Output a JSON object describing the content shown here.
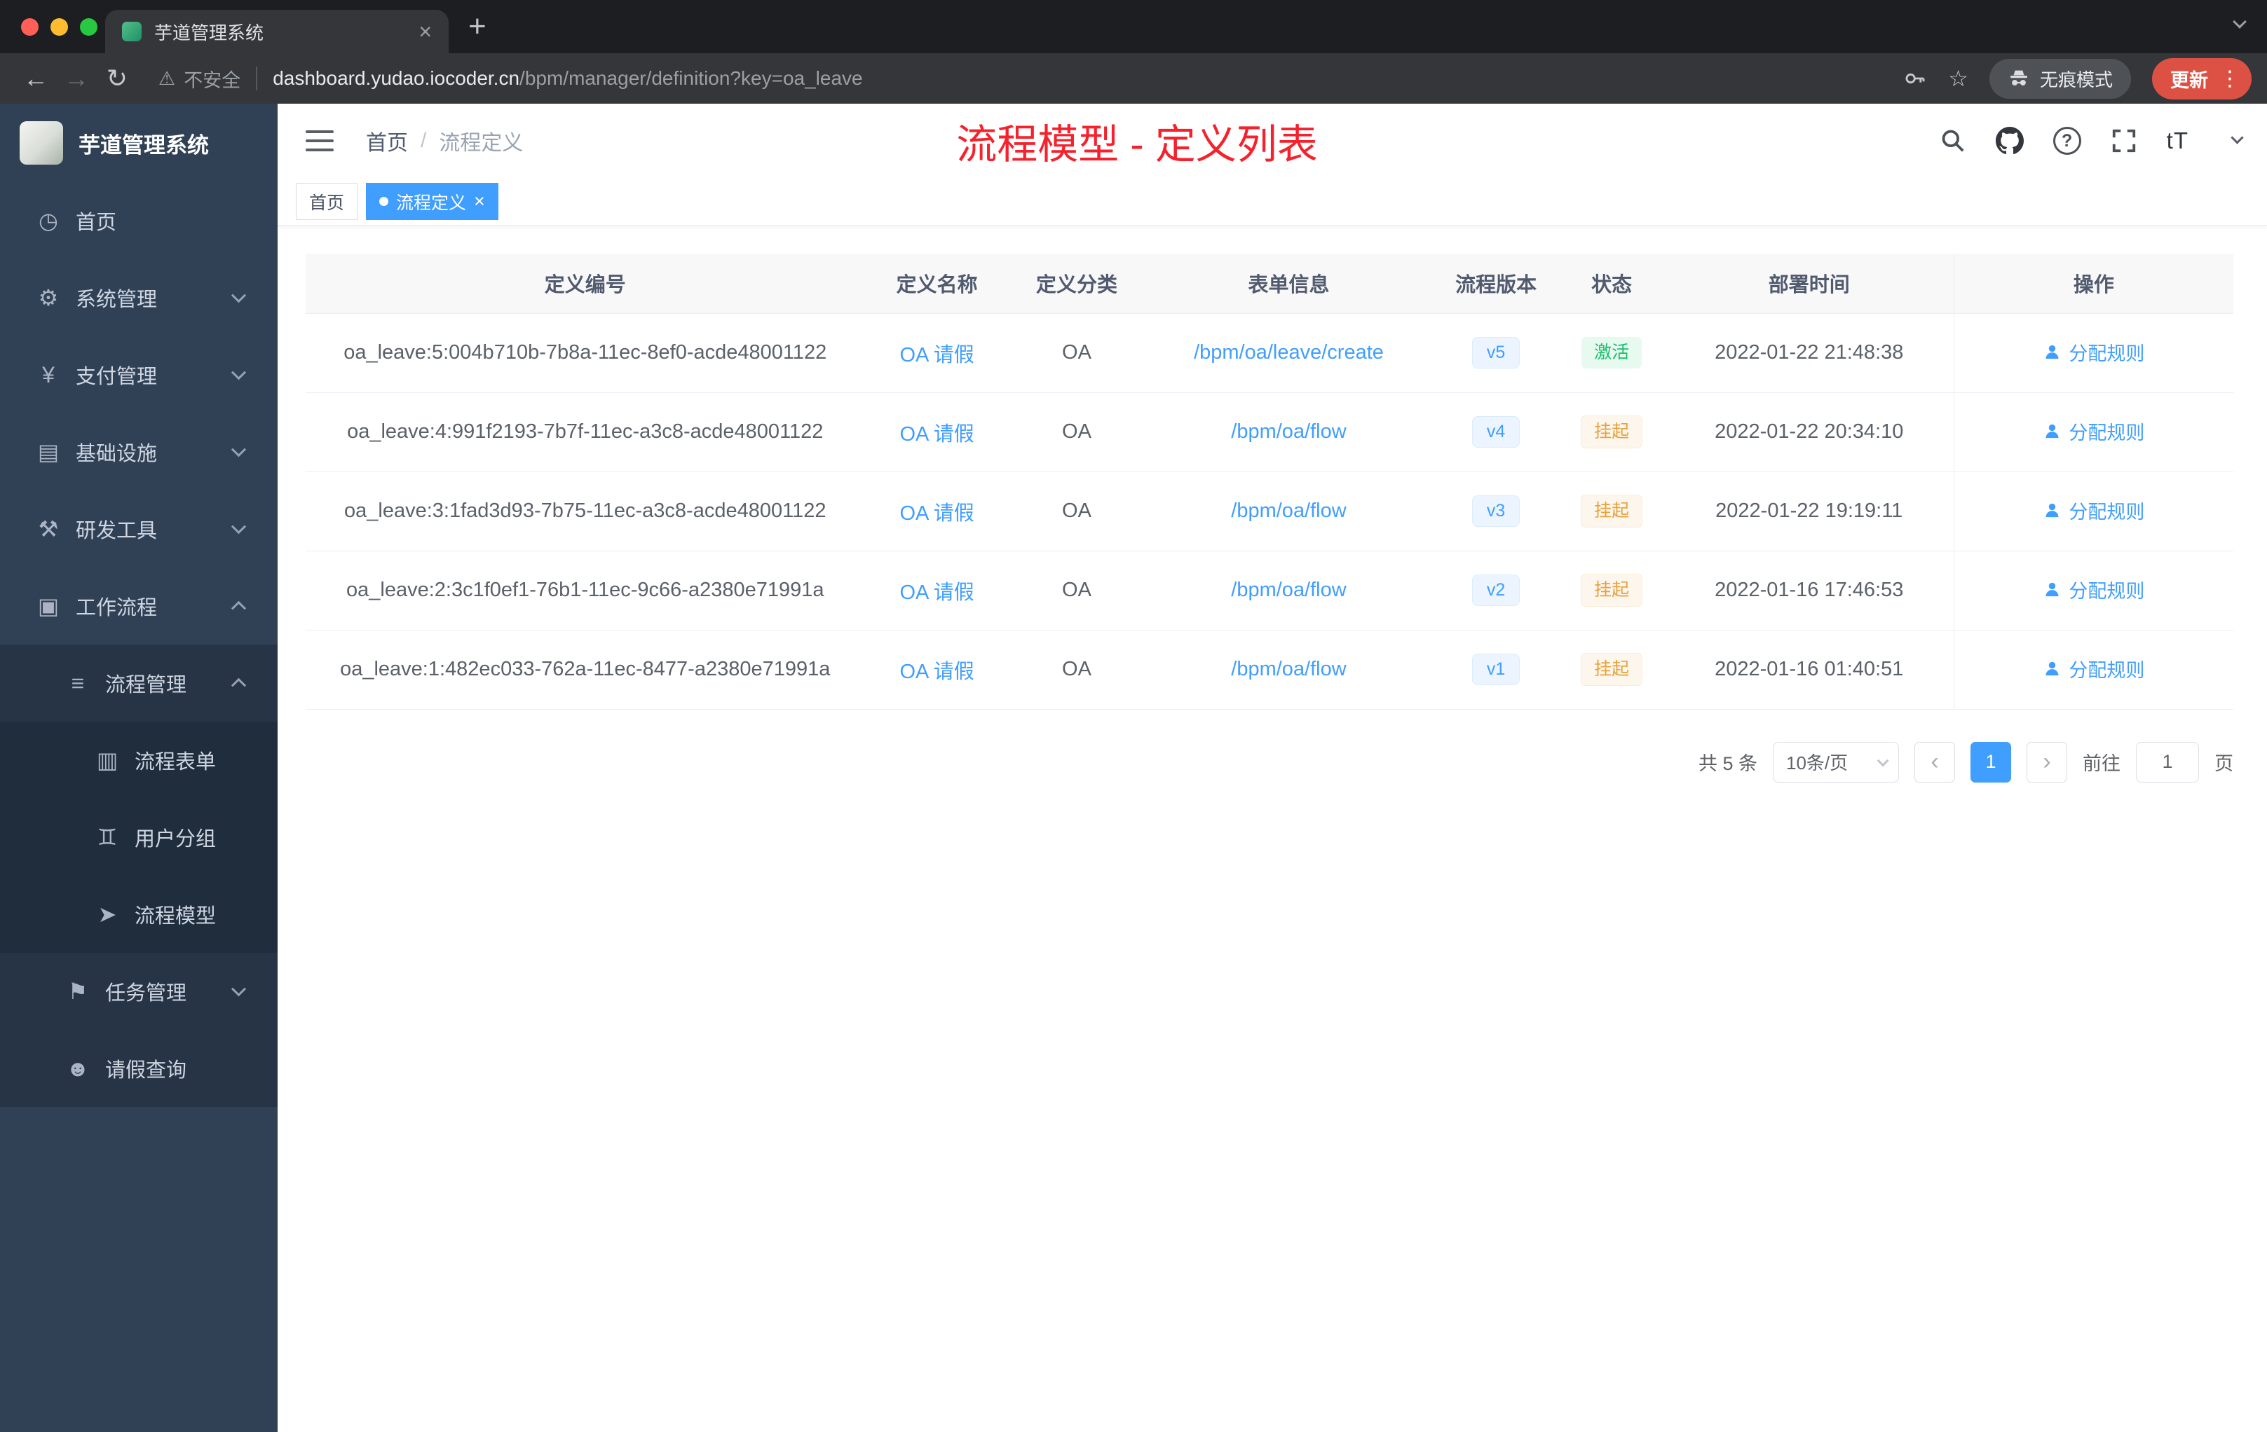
{
  "browser": {
    "tab_title": "芋道管理系统",
    "security_label": "不安全",
    "url_host": "dashboard.yudao.iocoder.cn",
    "url_path": "/bpm/manager/definition?key=oa_leave",
    "incognito_label": "无痕模式",
    "update_label": "更新"
  },
  "icons": {
    "back": "←",
    "forward": "→",
    "reload": "↻",
    "warning": "⚠",
    "star": "☆",
    "more": "⋮",
    "new_tab": "+",
    "tab_close": "×",
    "tag_close": "×",
    "help": "?",
    "text_size": "tT",
    "prev": "‹",
    "next": "›"
  },
  "sidebar": {
    "logo_title": "芋道管理系统",
    "menu": [
      {
        "label": "首页",
        "icon": "◷"
      },
      {
        "label": "系统管理",
        "icon": "⚙"
      },
      {
        "label": "支付管理",
        "icon": "¥"
      },
      {
        "label": "基础设施",
        "icon": "▤"
      },
      {
        "label": "研发工具",
        "icon": "⚒"
      },
      {
        "label": "工作流程",
        "icon": "▣"
      },
      {
        "label": "流程管理",
        "icon": "≡"
      },
      {
        "label": "流程表单",
        "icon": "▥"
      },
      {
        "label": "用户分组",
        "icon": "♊"
      },
      {
        "label": "流程模型",
        "icon": "➤"
      },
      {
        "label": "任务管理",
        "icon": "⚑"
      },
      {
        "label": "请假查询",
        "icon": "☻"
      }
    ]
  },
  "navbar": {
    "breadcrumb_home": "首页",
    "breadcrumb_sep": "/",
    "breadcrumb_current": "流程定义",
    "annotation": "流程模型 - 定义列表"
  },
  "tags": {
    "home": "首页",
    "active": "流程定义"
  },
  "table": {
    "columns": {
      "id": "定义编号",
      "name": "定义名称",
      "category": "定义分类",
      "form": "表单信息",
      "version": "流程版本",
      "status": "状态",
      "time": "部署时间",
      "actions": "操作"
    },
    "rows": [
      {
        "id": "oa_leave:5:004b710b-7b8a-11ec-8ef0-acde48001122",
        "name": "OA 请假",
        "category": "OA",
        "form": "/bpm/oa/leave/create",
        "version": "v5",
        "status": "激活",
        "time": "2022-01-22 21:48:38",
        "action": "分配规则"
      },
      {
        "id": "oa_leave:4:991f2193-7b7f-11ec-a3c8-acde48001122",
        "name": "OA 请假",
        "category": "OA",
        "form": "/bpm/oa/flow",
        "version": "v4",
        "status": "挂起",
        "time": "2022-01-22 20:34:10",
        "action": "分配规则"
      },
      {
        "id": "oa_leave:3:1fad3d93-7b75-11ec-a3c8-acde48001122",
        "name": "OA 请假",
        "category": "OA",
        "form": "/bpm/oa/flow",
        "version": "v3",
        "status": "挂起",
        "time": "2022-01-22 19:19:11",
        "action": "分配规则"
      },
      {
        "id": "oa_leave:2:3c1f0ef1-76b1-11ec-9c66-a2380e71991a",
        "name": "OA 请假",
        "category": "OA",
        "form": "/bpm/oa/flow",
        "version": "v2",
        "status": "挂起",
        "time": "2022-01-16 17:46:53",
        "action": "分配规则"
      },
      {
        "id": "oa_leave:1:482ec033-762a-11ec-8477-a2380e71991a",
        "name": "OA 请假",
        "category": "OA",
        "form": "/bpm/oa/flow",
        "version": "v1",
        "status": "挂起",
        "time": "2022-01-16 01:40:51",
        "action": "分配规则"
      }
    ]
  },
  "pagination": {
    "total": "共 5 条",
    "page_size": "10条/页",
    "current": "1",
    "goto_prefix": "前往",
    "goto_value": "1",
    "goto_suffix": "页"
  },
  "colors": {
    "accent": "#409eff",
    "success": "#19be6b",
    "warning": "#e6a23c",
    "annotation_red": "#f5222d",
    "sidebar_bg": "#304156",
    "update_badge": "#dd5144"
  }
}
